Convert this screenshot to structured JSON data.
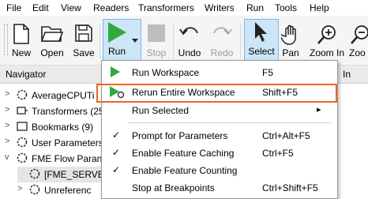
{
  "menubar": {
    "items": [
      "File",
      "Edit",
      "View",
      "Readers",
      "Transformers",
      "Writers",
      "Run",
      "Tools",
      "Help"
    ]
  },
  "toolbar": {
    "new": "New",
    "open": "Open",
    "save": "Save",
    "run": "Run",
    "stop": "Stop",
    "undo": "Undo",
    "redo": "Redo",
    "select": "Select",
    "pan": "Pan",
    "zoom_in": "Zoom In",
    "zoom_partial": "Zoo"
  },
  "navigator": {
    "title": "Navigator",
    "partial_tab": "In",
    "items": [
      {
        "label": "AverageCPUTi",
        "expand": ">"
      },
      {
        "label": "Transformers (25)",
        "expand": ">"
      },
      {
        "label": "Bookmarks (9)",
        "expand": ">"
      },
      {
        "label": "User Parameters",
        "expand": ">"
      },
      {
        "label": "FME Flow Paran",
        "expand": "v"
      },
      {
        "label": "[FME_SERVE",
        "expand": ""
      },
      {
        "label": "Unreferenc",
        "expand": ">"
      }
    ]
  },
  "run_menu": {
    "items": [
      {
        "label": "Run Workspace",
        "shortcut": "F5",
        "check": ""
      },
      {
        "label": "Rerun Entire Workspace",
        "shortcut": "Shift+F5",
        "check": ""
      },
      {
        "label": "Run Selected",
        "shortcut": "",
        "check": ""
      },
      {
        "label": "Prompt for Parameters",
        "shortcut": "Ctrl+Alt+F5",
        "check": "✓"
      },
      {
        "label": "Enable Feature Caching",
        "shortcut": "Ctrl+F5",
        "check": "✓"
      },
      {
        "label": "Enable Feature Counting",
        "shortcut": "",
        "check": "✓"
      },
      {
        "label": "Stop at Breakpoints",
        "shortcut": "Ctrl+Shift+F5",
        "check": ""
      }
    ],
    "submenu_arrow": "▸"
  },
  "colors": {
    "run_green": "#2eaa3a",
    "highlight": "#f26522",
    "selected_bg": "#cde6f7"
  }
}
